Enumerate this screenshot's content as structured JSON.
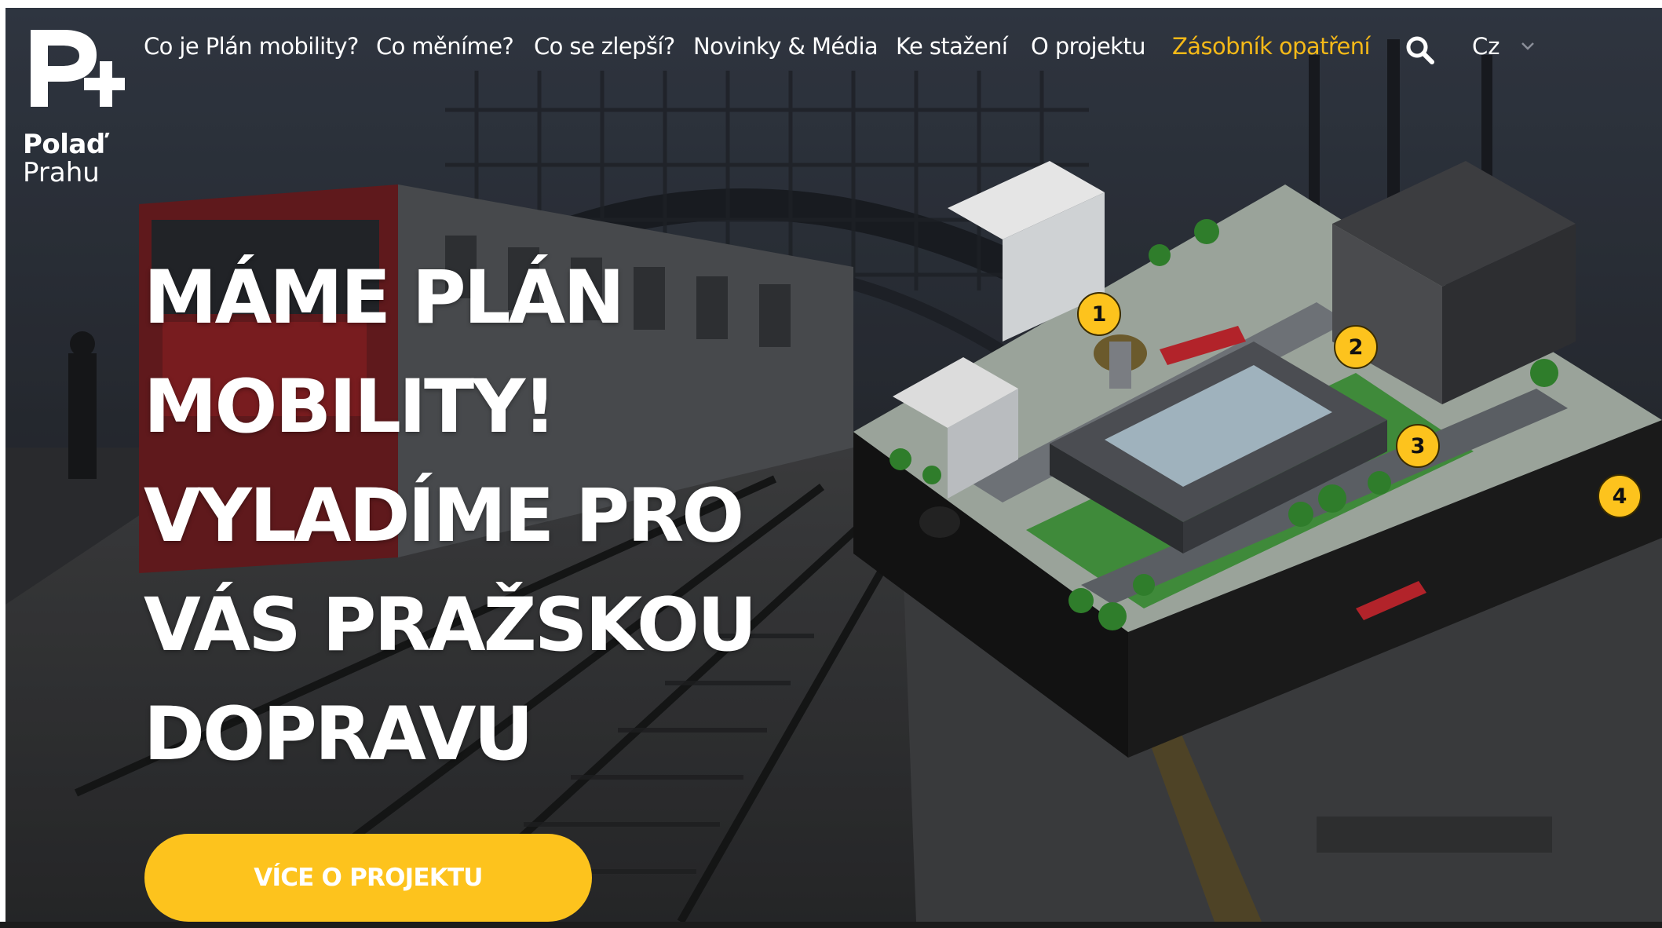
{
  "logo": {
    "mark": "P+",
    "line1": "Polaď",
    "line2": "Prahu"
  },
  "nav": {
    "items": [
      {
        "label": "Co je Plán mobility?"
      },
      {
        "label": "Co měníme?"
      },
      {
        "label": "Co se zlepší?"
      },
      {
        "label": "Novinky & Média"
      },
      {
        "label": "Ke stažení"
      },
      {
        "label": "O projektu"
      },
      {
        "label": "Zásobník opatření",
        "active": true
      }
    ],
    "search_icon": "search-icon",
    "language": "Cz"
  },
  "hero": {
    "headline": [
      "MÁME PLÁN",
      "MOBILITY!",
      "VYLADÍME PRO",
      "VÁS PRAŽSKOU",
      "DOPRAVU"
    ],
    "cta_label": "VÍCE O PROJEKTU"
  },
  "illustration": {
    "markers": [
      "1",
      "2",
      "3",
      "4"
    ]
  },
  "colors": {
    "accent": "#fdc31d",
    "nav_active": "#f5b918",
    "text": "#ffffff"
  }
}
